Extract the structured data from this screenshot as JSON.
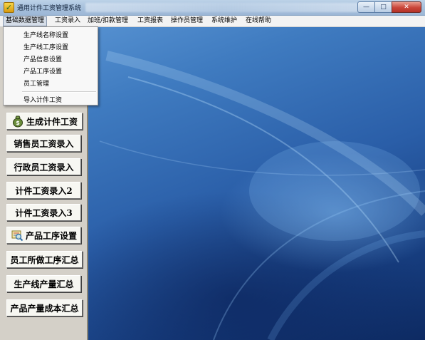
{
  "window": {
    "title": "通用计件工资管理系统",
    "controls": {
      "minimize": "—",
      "maximize": "□",
      "close": "✕"
    },
    "app_icon": "wage-app-icon"
  },
  "menubar": {
    "items": [
      {
        "label": "基础数据管理",
        "active": true
      },
      {
        "label": "工资录入"
      },
      {
        "label": "加班/扣款管理"
      },
      {
        "label": "工资报表"
      },
      {
        "label": "操作员管理"
      },
      {
        "label": "系统维护"
      },
      {
        "label": "在线帮助"
      }
    ]
  },
  "dropdown": {
    "items": [
      {
        "label": "生产线名称设置"
      },
      {
        "label": "生产线工序设置"
      },
      {
        "label": "产品信息设置"
      },
      {
        "label": "产品工序设置"
      },
      {
        "label": "员工管理"
      },
      {
        "label": "导入计件工资"
      }
    ]
  },
  "sidebar": {
    "buttons": [
      {
        "label": "生成计件工资",
        "icon": "money-bag-icon"
      },
      {
        "label": "销售员工资录入"
      },
      {
        "label": "行政员工资录入"
      },
      {
        "label": "计件工资录入2"
      },
      {
        "label": "计件工资录入3"
      },
      {
        "label": "产品工序设置",
        "icon": "settings-magnifier-icon"
      },
      {
        "label": "员工所做工序汇总"
      },
      {
        "label": "生产线产量汇总"
      },
      {
        "label": "产品产量成本汇总"
      }
    ]
  },
  "colors": {
    "desktop_top": "#5d98d6",
    "desktop_bottom": "#0d2a62",
    "panel": "#d4d0c8",
    "close_button": "#c9463a"
  }
}
